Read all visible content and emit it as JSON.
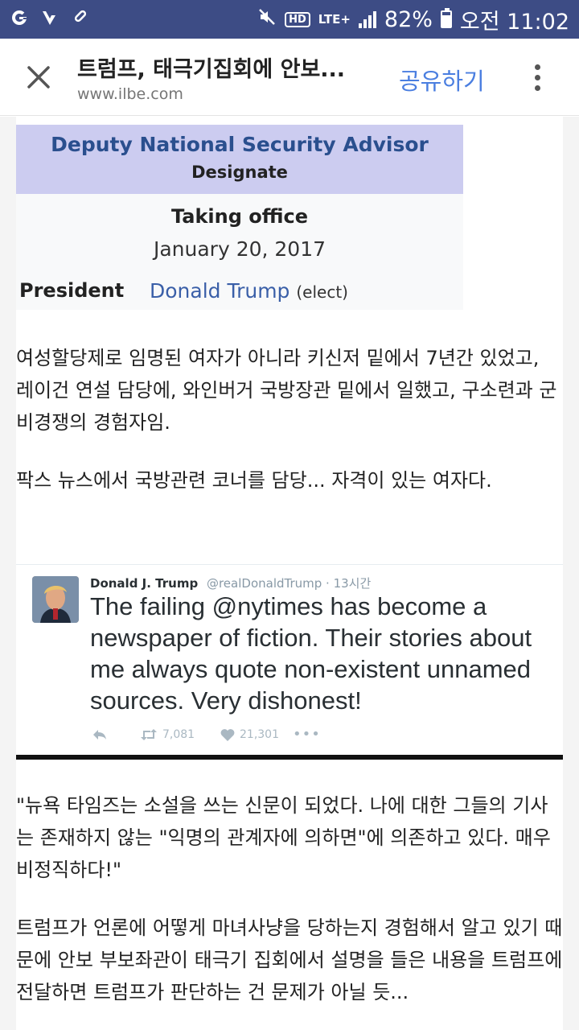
{
  "status_bar": {
    "battery_percent": "82%",
    "time": "오전 11:02",
    "network": "LTE",
    "network_plus": "+",
    "hd_label": "HD",
    "left_icons": [
      "g-notification-icon",
      "app-notification-icon",
      "pin-icon"
    ]
  },
  "app_bar": {
    "title": "트럼프, 태극기집회에 안보...",
    "url": "www.ilbe.com",
    "share_label": "공유하기"
  },
  "infobox": {
    "role": "Deputy National Security Advisor",
    "designate": "Designate",
    "taking_office": "Taking office",
    "date": "January 20, 2017",
    "president_label": "President",
    "president_value": "Donald Trump",
    "president_note": "(elect)"
  },
  "article": {
    "para1": "여성할당제로 임명된 여자가 아니라 키신저 밑에서 7년간 있었고, 레이건 연설 담당에, 와인버거 국방장관 밑에서 일했고, 구소련과 군비경쟁의 경험자임.",
    "para2": "팍스 뉴스에서 국방관련 코너를 담당... 자격이 있는 여자다.",
    "para3": "\"뉴욕 타임즈는 소설을 쓰는 신문이 되었다. 나에 대한 그들의 기사는 존재하지 않는 \"익명의 관계자에 의하면\"에 의존하고 있다. 매우 비정직하다!\"",
    "para4": "트럼프가 언론에 어떻게 마녀사냥을 당하는지 경험해서 알고 있기 때문에 안보 부보좌관이 태극기 집회에서 설명을 들은 내용을 트럼프에 전달하면 트럼프가 판단하는 건 문제가 아닐 듯..."
  },
  "tweet": {
    "name": "Donald J. Trump",
    "handle": "@realDonaldTrump · 13시간",
    "text": "The failing @nytimes has become a newspaper of fiction. Their stories about me always quote non-existent unnamed sources. Very dishonest!",
    "retweets": "7,081",
    "likes": "21,301",
    "colors": {
      "text": "#292f33",
      "muted": "#8899a6"
    }
  },
  "colors": {
    "status_bar": "#3d4c85",
    "share_accent": "#4a7ee0",
    "infobox_header": "#ccccf0",
    "infobox_role": "#2a4f8e",
    "link": "#3a5fa8"
  }
}
